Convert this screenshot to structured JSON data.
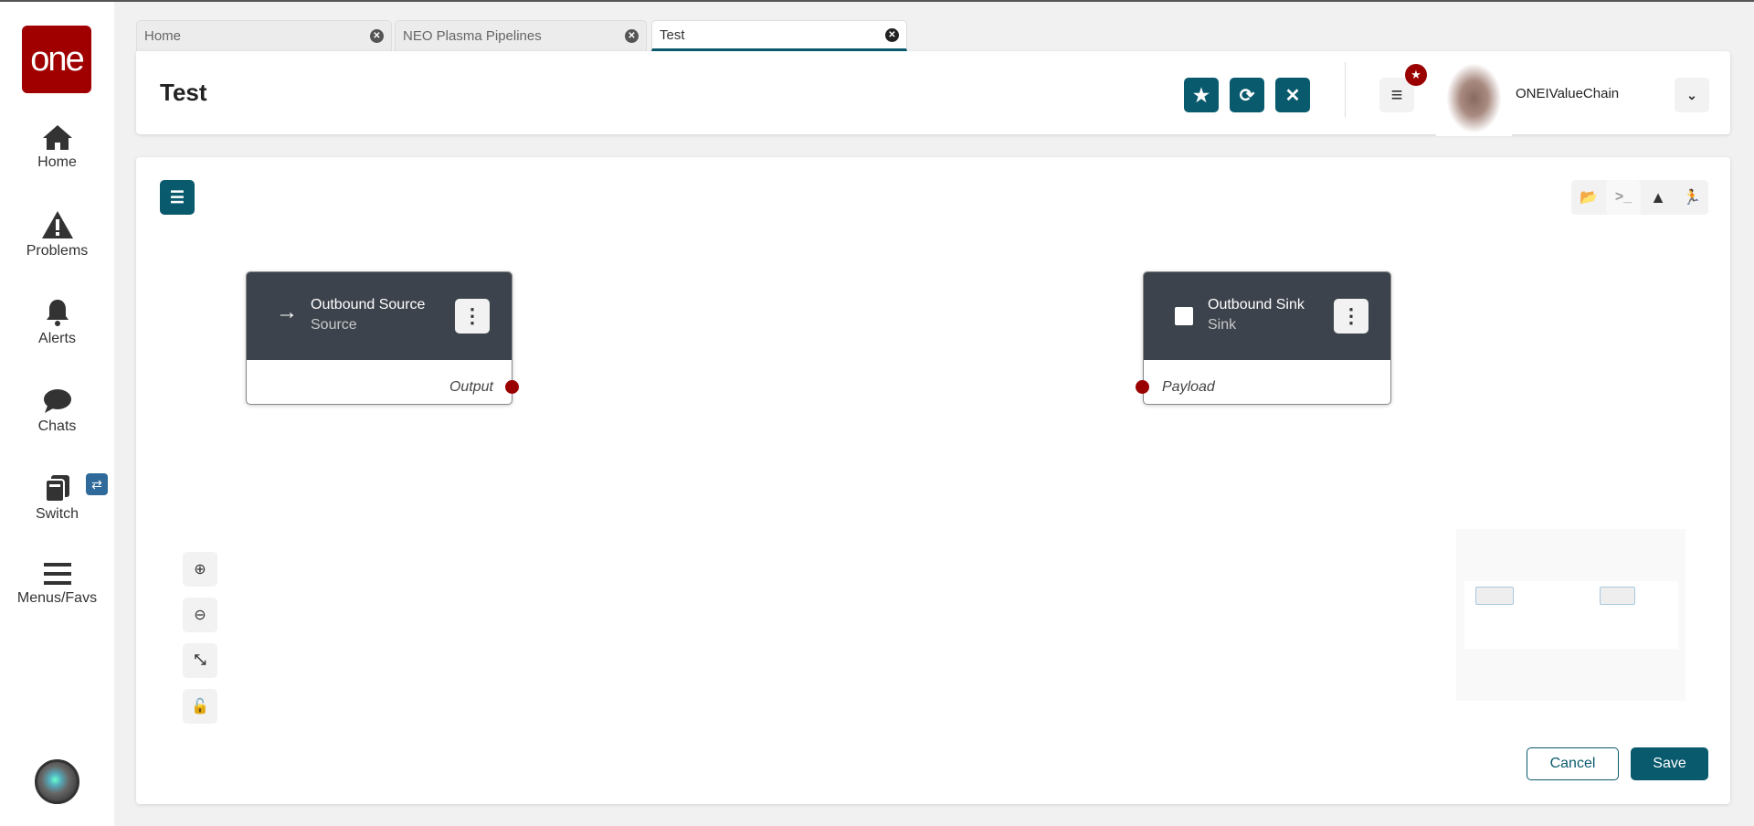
{
  "sidebar": {
    "logo": "one",
    "items": [
      {
        "label": "Home"
      },
      {
        "label": "Problems"
      },
      {
        "label": "Alerts"
      },
      {
        "label": "Chats"
      },
      {
        "label": "Switch"
      },
      {
        "label": "Menus/Favs"
      }
    ],
    "switch_badge": "⇄"
  },
  "tabs": [
    {
      "label": "Home"
    },
    {
      "label": "NEO Plasma Pipelines"
    },
    {
      "label": "Test"
    }
  ],
  "header": {
    "title": "Test",
    "org": "ONEIValueChain"
  },
  "nodes": [
    {
      "title": "Outbound Source",
      "subtitle": "Source",
      "port": "Output"
    },
    {
      "title": "Outbound Sink",
      "subtitle": "Sink",
      "port": "Payload"
    }
  ],
  "actions": {
    "cancel": "Cancel",
    "save": "Save"
  },
  "colors": {
    "accent": "#0a5a6e",
    "brand": "#a00000",
    "node_header": "#3d434c",
    "port": "#9a0000"
  }
}
